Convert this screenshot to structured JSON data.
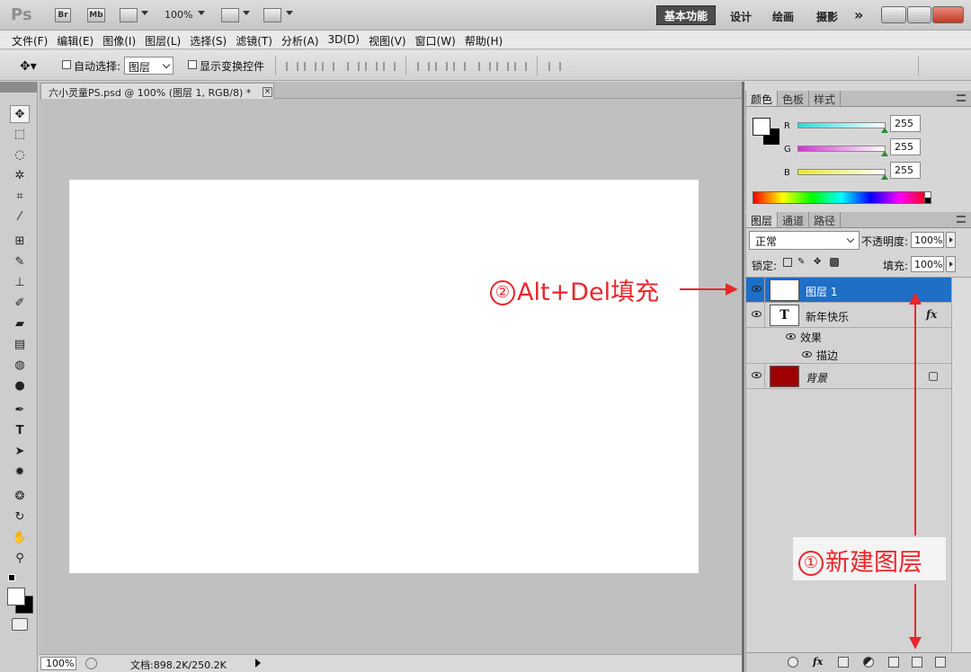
{
  "app": {
    "logo": "Ps",
    "launch_buttons": [
      "Br",
      "Mb"
    ],
    "zoom": "100%",
    "workspaces": {
      "active": "基本功能",
      "others": [
        "设计",
        "绘画",
        "摄影"
      ],
      "more": "»"
    }
  },
  "menu": [
    "文件(F)",
    "编辑(E)",
    "图像(I)",
    "图层(L)",
    "选择(S)",
    "滤镜(T)",
    "分析(A)",
    "3D(D)",
    "视图(V)",
    "窗口(W)",
    "帮助(H)"
  ],
  "options": {
    "auto_select_label": "自动选择:",
    "auto_select_value": "图层",
    "show_transform_label": "显示变换控件"
  },
  "document": {
    "tab_title": "六小灵童PS.psd @ 100% (图层 1, RGB/8) *",
    "close_glyph": "×"
  },
  "status": {
    "zoom": "100%",
    "doc_info": "文档:898.2K/250.2K"
  },
  "color_panel": {
    "tabs": [
      "颜色",
      "色板",
      "样式"
    ],
    "channels": [
      {
        "label": "R",
        "value": "255",
        "color": "#2fd8d8"
      },
      {
        "label": "G",
        "value": "255",
        "color": "#d82fd8"
      },
      {
        "label": "B",
        "value": "255",
        "color": "#e8e82f"
      }
    ]
  },
  "layers_panel": {
    "tabs": [
      "图层",
      "通道",
      "路径"
    ],
    "blend_mode": "正常",
    "opacity_label": "不透明度:",
    "opacity": "100%",
    "lock_label": "锁定:",
    "fill_label": "填充:",
    "fill": "100%",
    "layers": [
      {
        "name": "图层 1",
        "selected": true,
        "thumb_color": "#ffffff"
      },
      {
        "name": "新年快乐",
        "thumb_glyph": "T",
        "fx": "fx"
      },
      {
        "name": "效果"
      },
      {
        "name": "描边"
      },
      {
        "name": "背景",
        "thumb_color": "#a00000"
      }
    ]
  },
  "annotations": {
    "step1_number": "①",
    "step1_text": "新建图层",
    "step2_number": "②",
    "step2_text": "Alt+Del填充",
    "color": "#e8262c"
  }
}
